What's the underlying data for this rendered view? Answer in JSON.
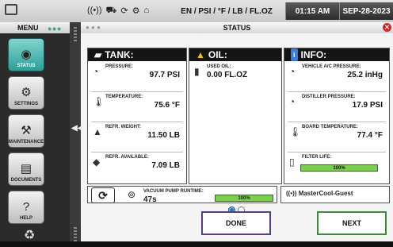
{
  "topbar": {
    "units": "EN / PSI / °F / LB / FL.OZ",
    "time": "01:15 AM",
    "date": "SEP-28-2023"
  },
  "menu": {
    "title": "MENU",
    "items": [
      {
        "label": "STATUS",
        "icon": "status-icon",
        "active": true
      },
      {
        "label": "SETTINGS",
        "icon": "gear-icon"
      },
      {
        "label": "MAINTENANCE",
        "icon": "tools-icon"
      },
      {
        "label": "DOCUMENTS",
        "icon": "document-icon"
      },
      {
        "label": "HELP",
        "icon": "help-icon"
      }
    ]
  },
  "window": {
    "title": "STATUS"
  },
  "tank": {
    "title": "TANK:",
    "pressure_label": "PRESSURE:",
    "pressure_value": "97.7 PSI",
    "temperature_label": "TEMPERATURE:",
    "temperature_value": "75.6 °F",
    "refr_weight_label": "REFR. WEIGHT:",
    "refr_weight_value": "11.50 LB",
    "refr_available_label": "REFR. AVAILABLE:",
    "refr_available_value": "7.09 LB"
  },
  "oil": {
    "title": "OIL:",
    "used_oil_label": "USED OIL:",
    "used_oil_value": "0.00 FL.OZ"
  },
  "info": {
    "title": "INFO:",
    "vehicle_pressure_label": "VEHICLE A/C PRESSURE:",
    "vehicle_pressure_value": "25.2 inHg",
    "distiller_pressure_label": "DISTILLER PRESSURE:",
    "distiller_pressure_value": "17.9 PSI",
    "board_temp_label": "BOARD TEMPERATURE:",
    "board_temp_value": "77.4 °F",
    "filter_life_label": "FILTER LIFE:",
    "filter_life_value": "100%"
  },
  "pump": {
    "label": "VACUUM PUMP RUNTIME:",
    "runtime": "47s",
    "bar_value": "100%"
  },
  "wifi": {
    "ssid": "MasterCool-Guest"
  },
  "buttons": {
    "done": "DONE",
    "next": "NEXT"
  }
}
